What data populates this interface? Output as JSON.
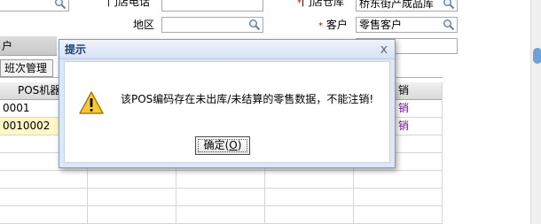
{
  "form": {
    "top_field_1_value": "",
    "store_phone_label": "门店电话",
    "store_phone_value": "",
    "store_warehouse_label": "门店仓库",
    "store_warehouse_value": "桥东街产成品库",
    "region_label": "地区",
    "region_value": "",
    "customer_label": "客户",
    "customer_value": "零售客户",
    "required_mark": "*"
  },
  "section": {
    "title": "户"
  },
  "tabs": [
    {
      "label": "班次管理"
    }
  ],
  "grid": {
    "headers": {
      "pos_machine": "POS机器",
      "right_header": "销"
    },
    "rows": [
      {
        "pos": "0001",
        "right": "销",
        "highlight": false
      },
      {
        "pos": "0010002",
        "right": "销",
        "highlight": true
      }
    ]
  },
  "dialog": {
    "title": "提示",
    "close_glyph": "x",
    "message": "该POS编码存在未出库/未结算的零售数据，不能注销!",
    "ok_label": "确定(",
    "ok_hotkey": "O",
    "ok_suffix": ")"
  },
  "colors": {
    "dialog_title": "#1a3d73",
    "required": "#d00000",
    "link_purple": "#7a0c9c",
    "highlight_row": "#fff7c6",
    "scroll_thumb": "#6fa0d8"
  }
}
